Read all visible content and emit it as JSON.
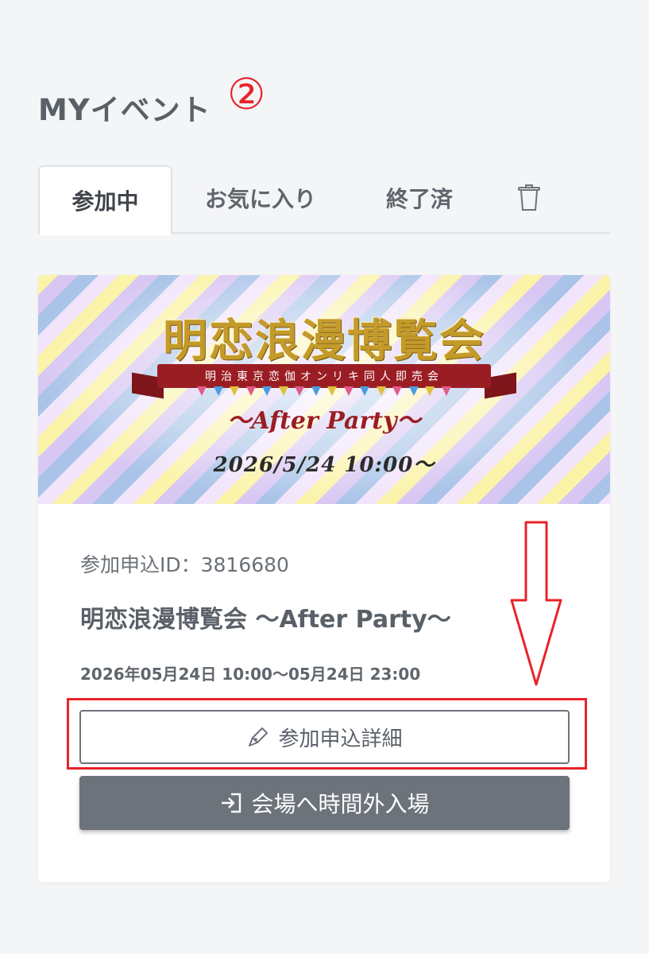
{
  "header": {
    "title": "MYイベント",
    "step_marker": "②"
  },
  "tabs": [
    {
      "label": "参加中",
      "active": true
    },
    {
      "label": "お気に入り",
      "active": false
    },
    {
      "label": "終了済",
      "active": false
    }
  ],
  "tab_icon": "trash-icon",
  "event": {
    "banner": {
      "title": "明恋浪漫博覧会",
      "ribbon_text": "明治東京恋伽オンリキ同人即売会",
      "subtitle": "〜After Party〜",
      "date": "2026/5/24 10:00〜"
    },
    "application_id": "参加申込ID：3816680",
    "name": "明恋浪漫博覧会 〜After Party〜",
    "datetime": "2026年05月24日 10:00〜05月24日 23:00",
    "detail_button": {
      "label": "参加申込詳細",
      "icon": "pen-icon"
    },
    "enter_button": {
      "label": "会場へ時間外入場",
      "icon": "sign-in-icon"
    }
  },
  "annotation": {
    "color": "#e8232a"
  },
  "colors": {
    "background": "#f4f5f7",
    "card": "#ffffff",
    "button_dark": "#6c737a",
    "text": "#5a6068"
  }
}
